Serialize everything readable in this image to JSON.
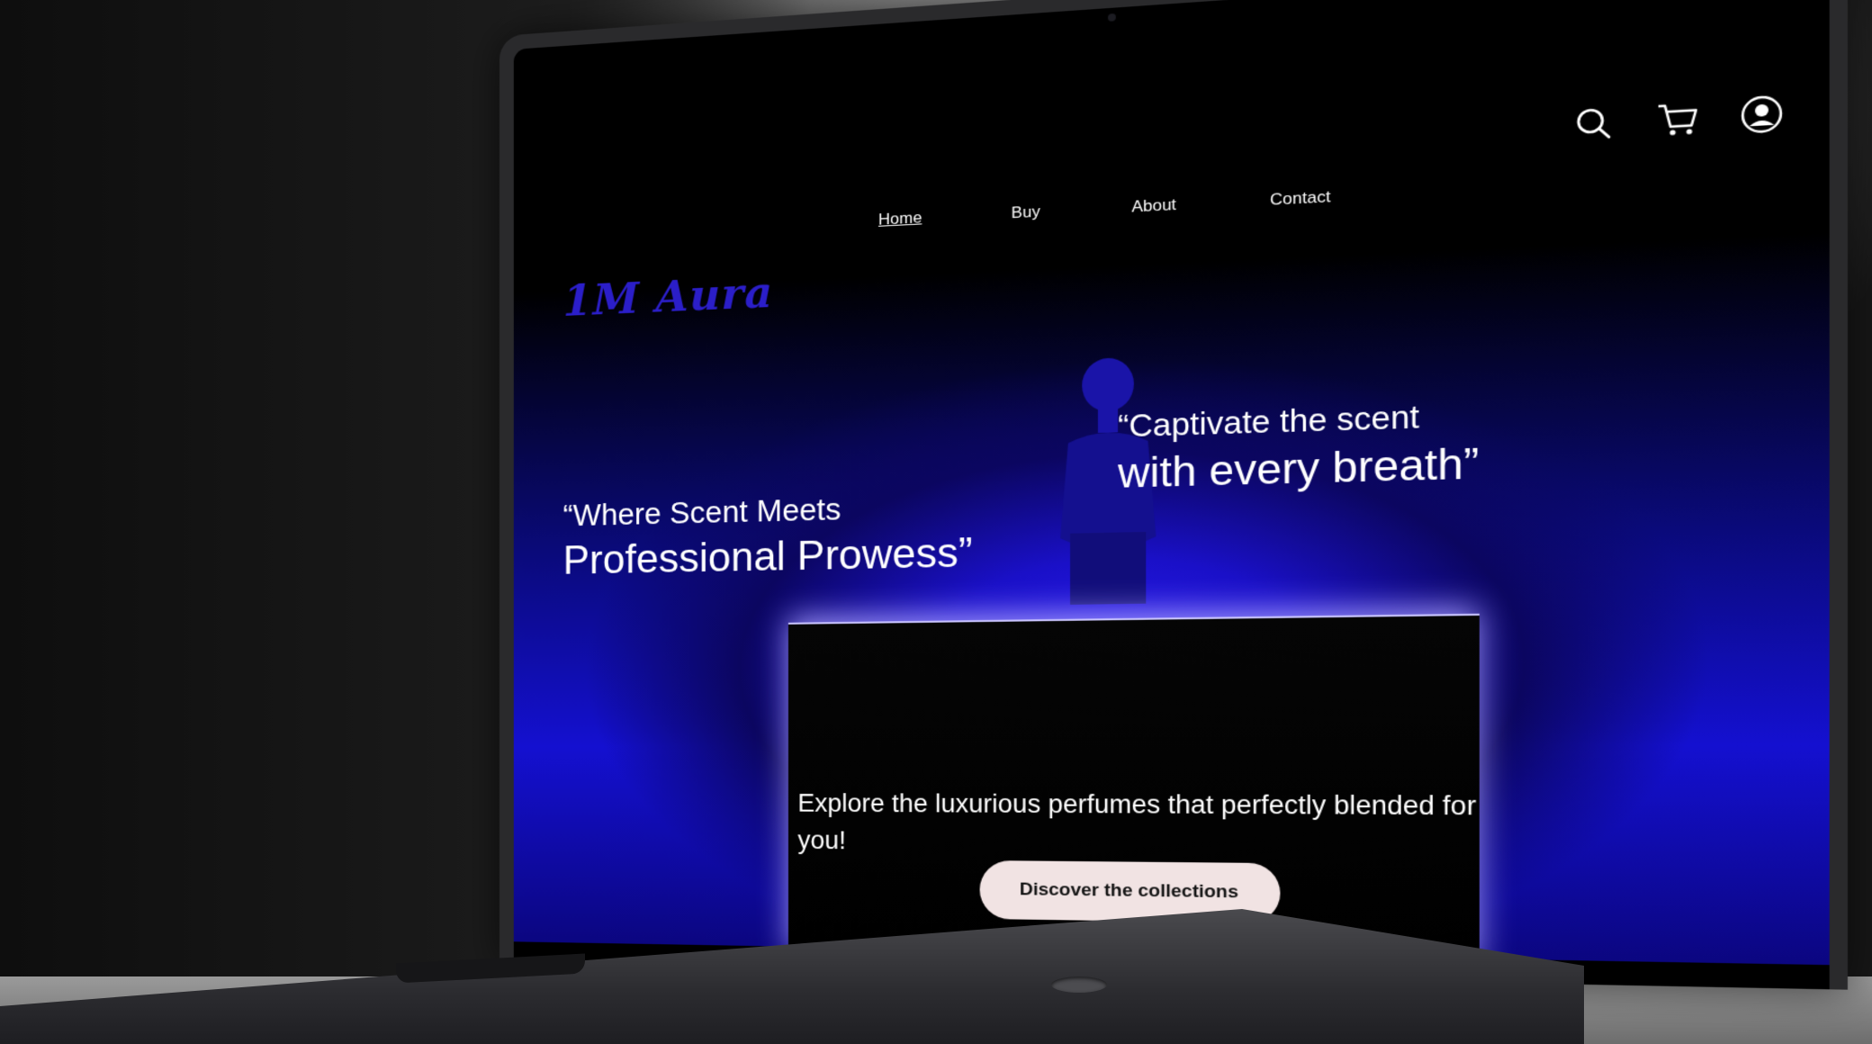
{
  "brand": {
    "logo_text": "1M Aura",
    "logo_color": "#2b1ec9"
  },
  "nav": {
    "items": [
      {
        "label": "Home",
        "active": true
      },
      {
        "label": "Buy",
        "active": false
      },
      {
        "label": "About",
        "active": false
      },
      {
        "label": "Contact",
        "active": false
      }
    ]
  },
  "header_icons": [
    "search-icon",
    "cart-icon",
    "user-icon"
  ],
  "hero": {
    "quote_left": {
      "line1": "“Where Scent Meets",
      "line2": "Professional Prowess”"
    },
    "quote_right": {
      "line1": "“Captivate the scent",
      "line2": "with every breath”"
    },
    "tagline": "Explore the luxurious perfumes that perfectly blended for you!",
    "cta_label": "Discover the collections",
    "accent_color": "#1a10c8",
    "cta_color": "#f1e3e3"
  }
}
